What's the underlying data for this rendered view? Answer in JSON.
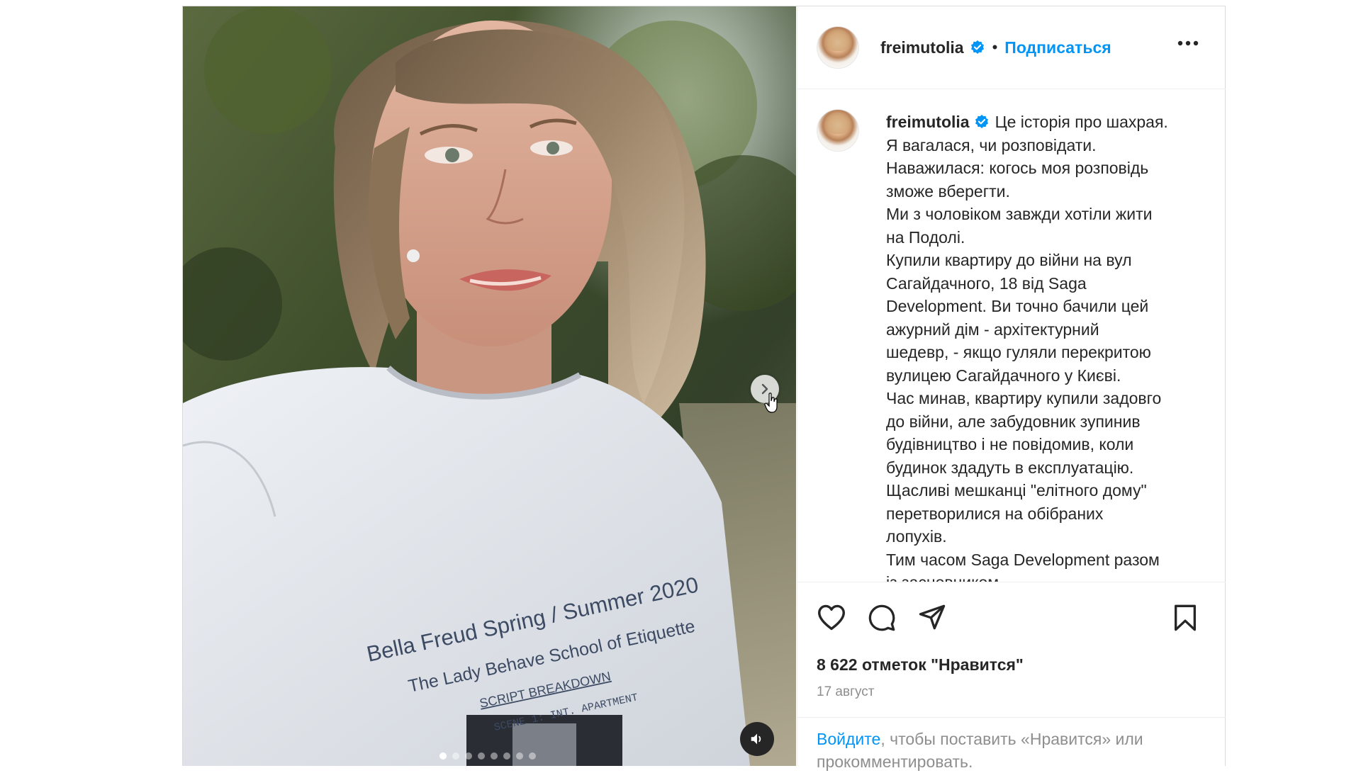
{
  "post": {
    "author": {
      "username": "freimutolia",
      "verified": true,
      "follow_label": "Подписаться",
      "separator": "•"
    },
    "caption": {
      "lines": [
        "Це історія про шахрая.",
        "Я вагалася, чи розповідати.",
        "Наважилася: когось моя розповідь",
        "зможе вберегти.",
        "Ми з чоловіком завжди хотіли жити",
        "на Подолі.",
        "Купили квартиру до війни на вул",
        "Сагайдачного, 18 від Saga",
        "Development. Ви точно бачили цей",
        "ажурний дім - архітектурний",
        "шедевр, - якщо гуляли перекритою",
        "вулицею Сагайдачного у Києві.",
        "Час минав, квартиру купили задовго",
        "до війни, але забудовник зупинив",
        "будівництво і не повідомив, коли",
        "будинок здадуть в експлуатацію.",
        "Щасливі мешканці \"елітного дому\"",
        "перетворилися на обібраних",
        "лопухів.",
        "Тим часом Saga Development разом",
        "із засновником"
      ]
    },
    "likes_text": "8 622 отметок \"Нравится\"",
    "date_text": "17 август",
    "login_prompt": {
      "link_text": "Войдите",
      "rest_text": ", чтобы поставить «Нравится» или прокомментировать."
    },
    "media": {
      "shirt_text": [
        "Bella Freud Spring / Summer 2020",
        "The Lady Behave School of Etiquette",
        "SCRIPT BREAKDOWN",
        "SCENE 1: INT. APARTMENT"
      ],
      "carousel_count": 8,
      "carousel_active_index": 0
    },
    "icons": {
      "verified": "verified-badge-icon",
      "more": "more-options-icon",
      "like": "heart-icon",
      "comment": "comment-icon",
      "share": "paper-plane-icon",
      "save": "bookmark-icon",
      "next": "chevron-right-icon",
      "mute": "speaker-icon"
    },
    "colors": {
      "accent": "#0095f6",
      "text": "#262626",
      "muted": "#8e8e8e",
      "border": "#efefef"
    }
  }
}
